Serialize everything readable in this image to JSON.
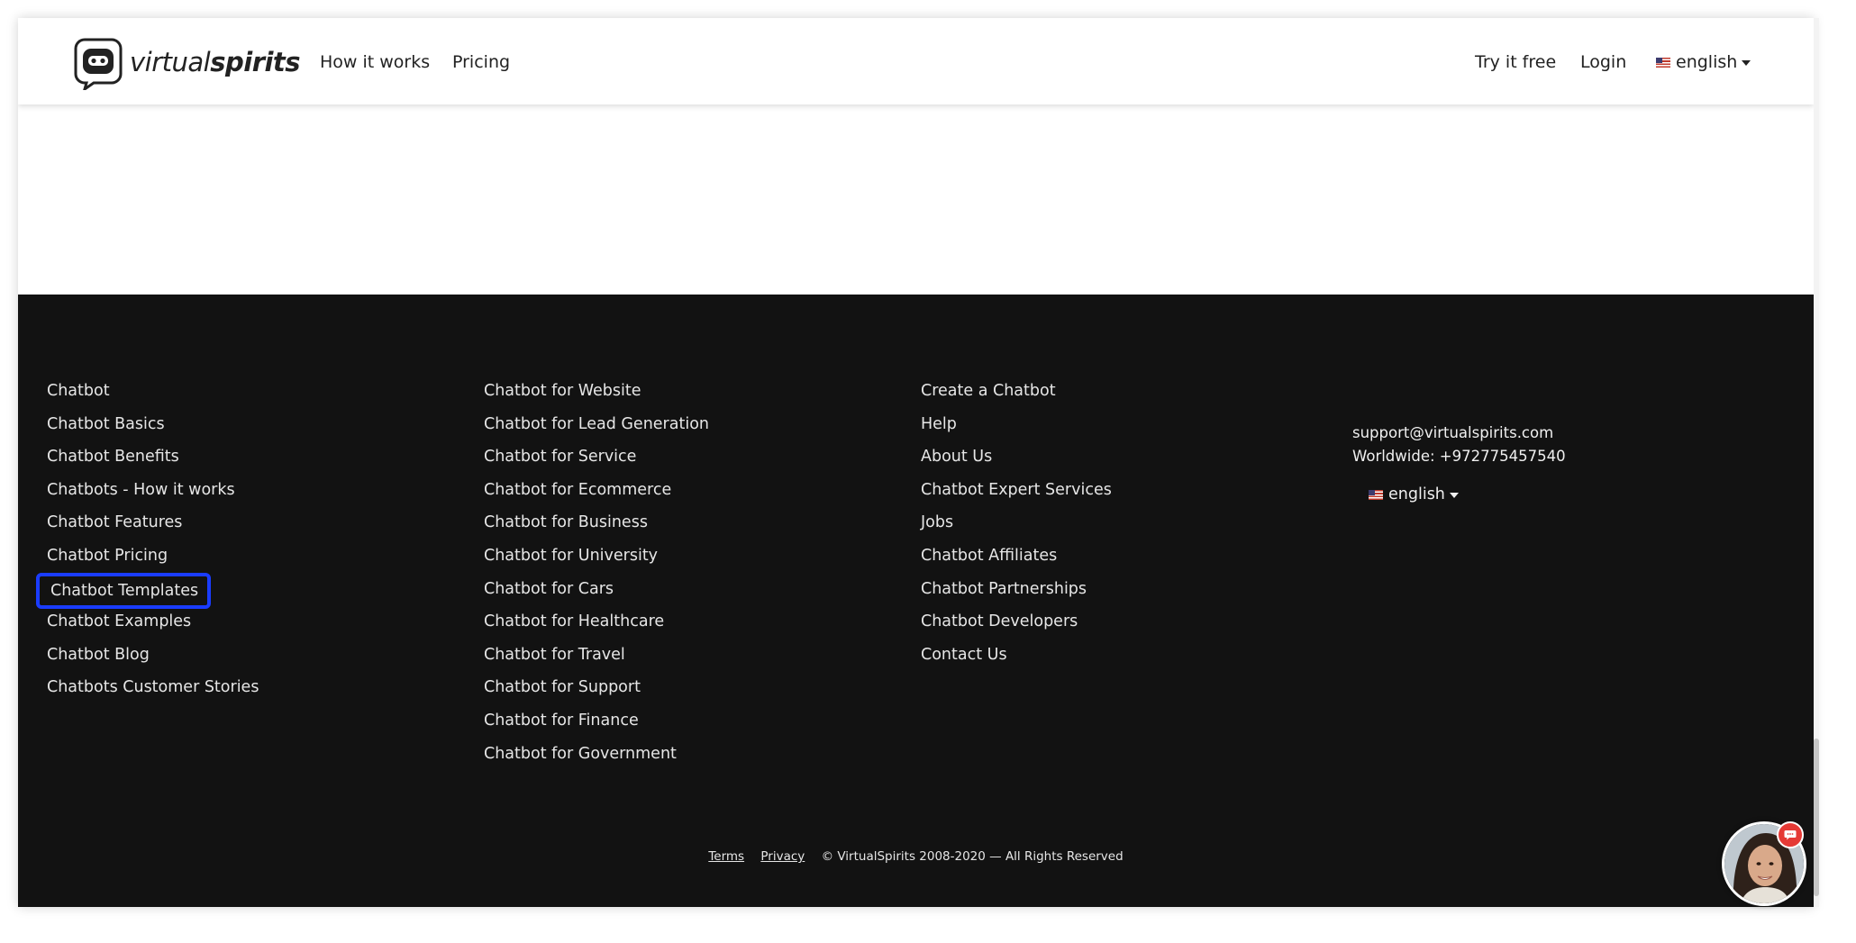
{
  "header": {
    "logo_text_light": "virtual",
    "logo_text_bold": "spirits",
    "nav": {
      "how_it_works": "How it works",
      "pricing": "Pricing",
      "try_free": "Try it free",
      "login": "Login",
      "language": "english"
    }
  },
  "footer": {
    "col1": [
      "Chatbot",
      "Chatbot Basics",
      "Chatbot Benefits",
      "Chatbots - How it works",
      "Chatbot Features",
      "Chatbot Pricing",
      "Chatbot Templates",
      "Chatbot Examples",
      "Chatbot Blog",
      "Chatbots Customer Stories"
    ],
    "col2": [
      "Chatbot for Website",
      "Chatbot for Lead Generation",
      "Chatbot for Service",
      "Chatbot for Ecommerce",
      "Chatbot for Business",
      "Chatbot for University",
      "Chatbot for Cars",
      "Chatbot for Healthcare",
      "Chatbot for Travel",
      "Chatbot for Support",
      "Chatbot for Finance",
      "Chatbot for Government"
    ],
    "col3": [
      "Create a Chatbot",
      "Help",
      "About Us",
      "Chatbot Expert Services",
      "Jobs",
      "Chatbot Affiliates",
      "Chatbot Partnerships",
      "Chatbot Developers",
      "Contact Us"
    ],
    "contact": {
      "email": "support@virtualspirits.com",
      "phone": "Worldwide: +972775457540"
    },
    "language": "english",
    "bottom": {
      "terms": "Terms",
      "privacy": "Privacy",
      "copyright": "© VirtualSpirits 2008-2020 — All Rights Reserved"
    }
  },
  "colors": {
    "footer_bg": "#121212",
    "highlight": "#1a3cff",
    "badge": "#e53935"
  }
}
